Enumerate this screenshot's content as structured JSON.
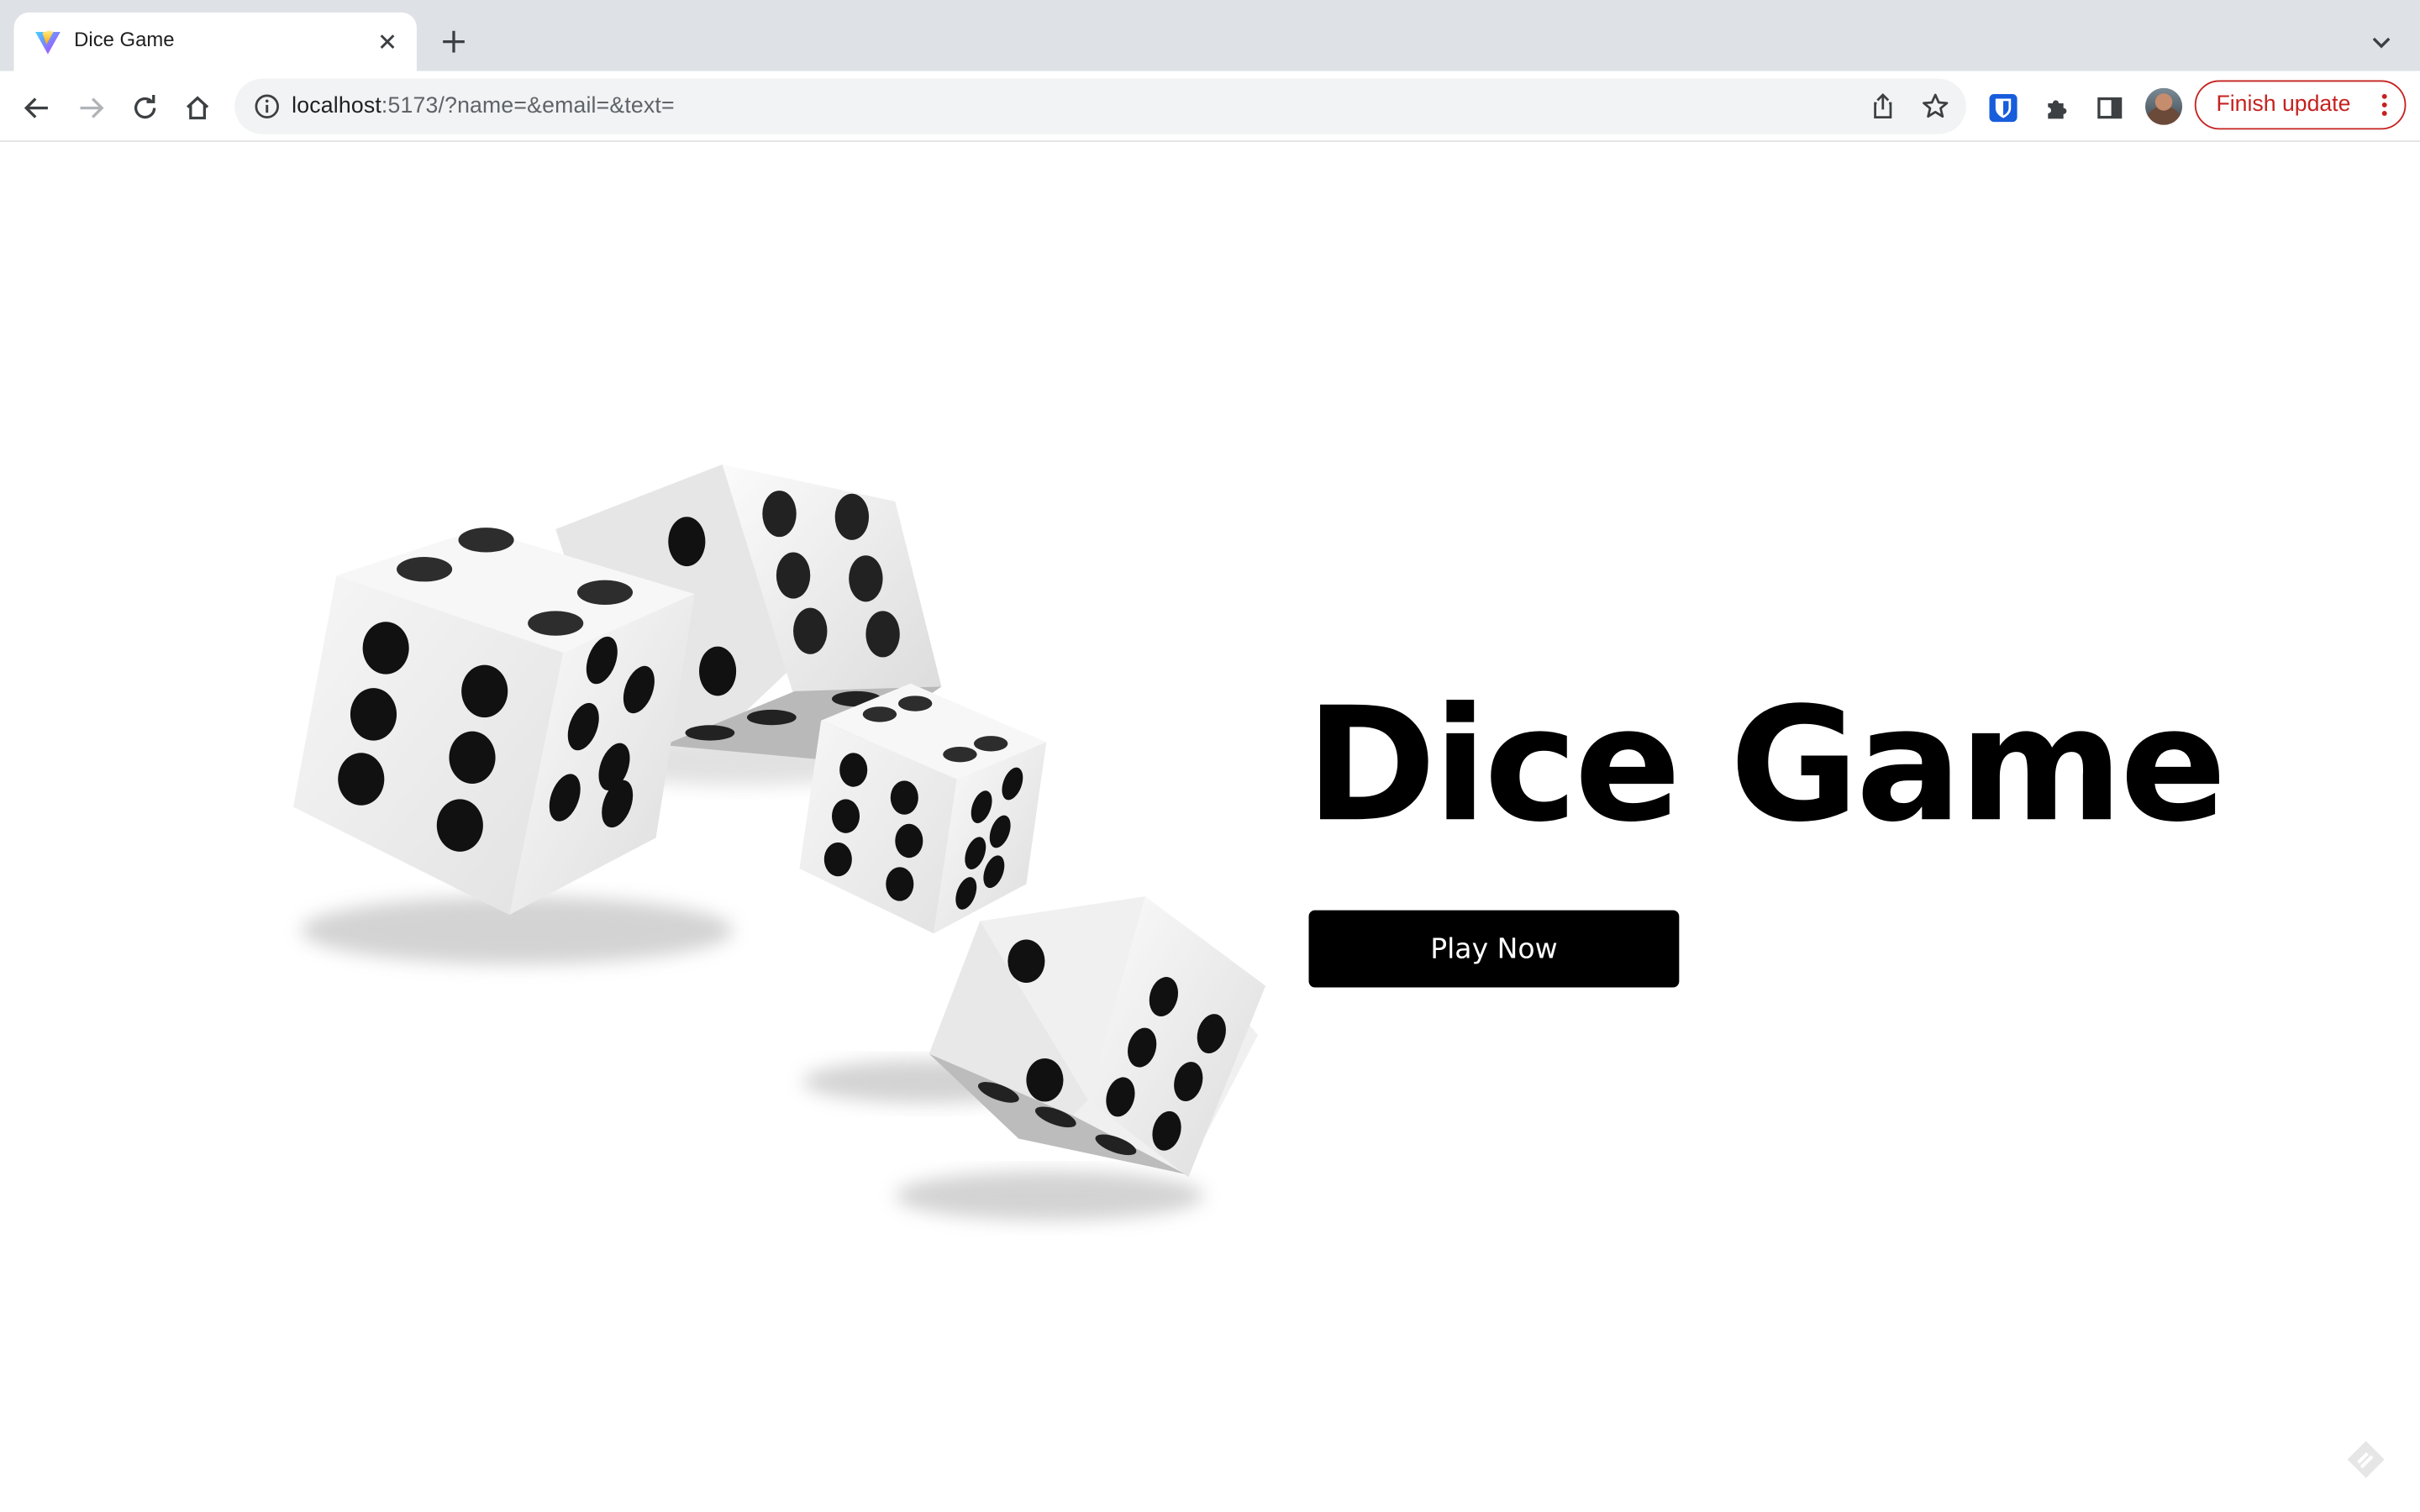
{
  "browser": {
    "tab": {
      "title": "Dice Game",
      "favicon": "vite-logo-icon"
    },
    "toolbar": {
      "back": "arrow-left-icon",
      "forward": "arrow-right-icon",
      "reload": "reload-icon",
      "home": "home-icon",
      "url_host": "localhost",
      "url_rest": ":5173/?name=&email=&text=",
      "share": "share-icon",
      "bookmark": "star-icon",
      "extensions": [
        "bitwarden-icon",
        "puzzle-icon",
        "side-panel-icon"
      ],
      "finish_update_label": "Finish update",
      "accent_color": "#c5221f"
    }
  },
  "page": {
    "hero": {
      "title": "Dice Game",
      "button_label": "Play Now",
      "illustration": "dice-illustration"
    },
    "colors": {
      "text": "#000000",
      "button_bg": "#000000",
      "button_text": "#ffffff",
      "background": "#ffffff"
    }
  }
}
